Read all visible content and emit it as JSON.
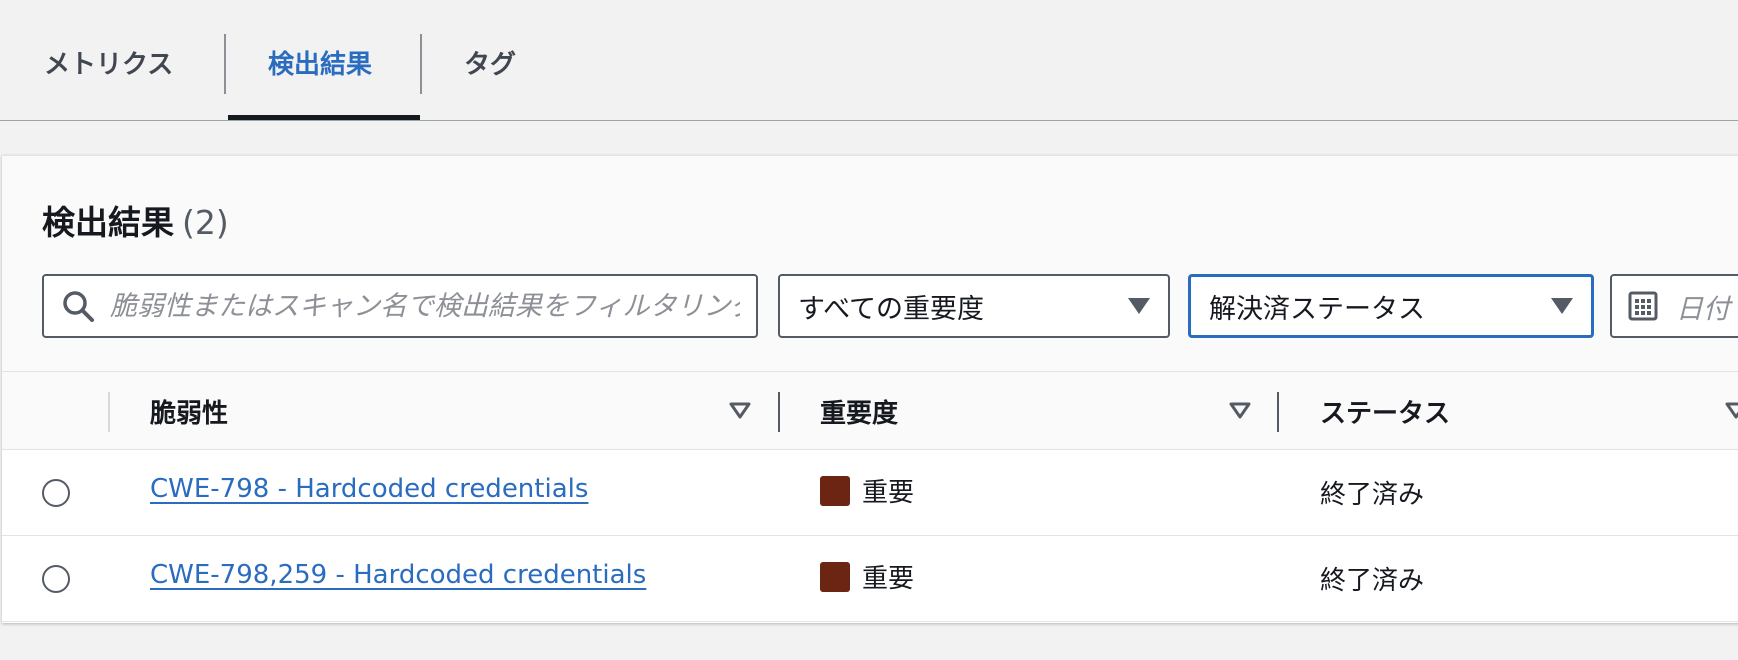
{
  "tabs": [
    {
      "label": "メトリクス",
      "active": false
    },
    {
      "label": "検出結果",
      "active": true
    },
    {
      "label": "タグ",
      "active": false
    }
  ],
  "panel": {
    "title": "検出結果",
    "count": "(2)"
  },
  "filters": {
    "search_placeholder": "脆弱性またはスキャン名で検出結果をフィルタリング",
    "severity_select": "すべての重要度",
    "status_select": "解決済ステータス",
    "date_placeholder": "日付"
  },
  "table": {
    "columns": [
      {
        "label": "脆弱性"
      },
      {
        "label": "重要度"
      },
      {
        "label": "ステータス"
      }
    ],
    "rows": [
      {
        "vulnerability": "CWE-798 - Hardcoded credentials",
        "severity": "重要",
        "status": "終了済み"
      },
      {
        "vulnerability": "CWE-798,259 - Hardcoded credentials",
        "severity": "重要",
        "status": "終了済み"
      }
    ]
  },
  "colors": {
    "accent": "#2a6cbf",
    "severity_critical": "#6b2512",
    "focus_border": "#2a6cbf"
  },
  "icons": {
    "search": "search-icon",
    "caret": "caret-down-icon",
    "calendar": "calendar-icon",
    "sort": "sort-icon"
  }
}
